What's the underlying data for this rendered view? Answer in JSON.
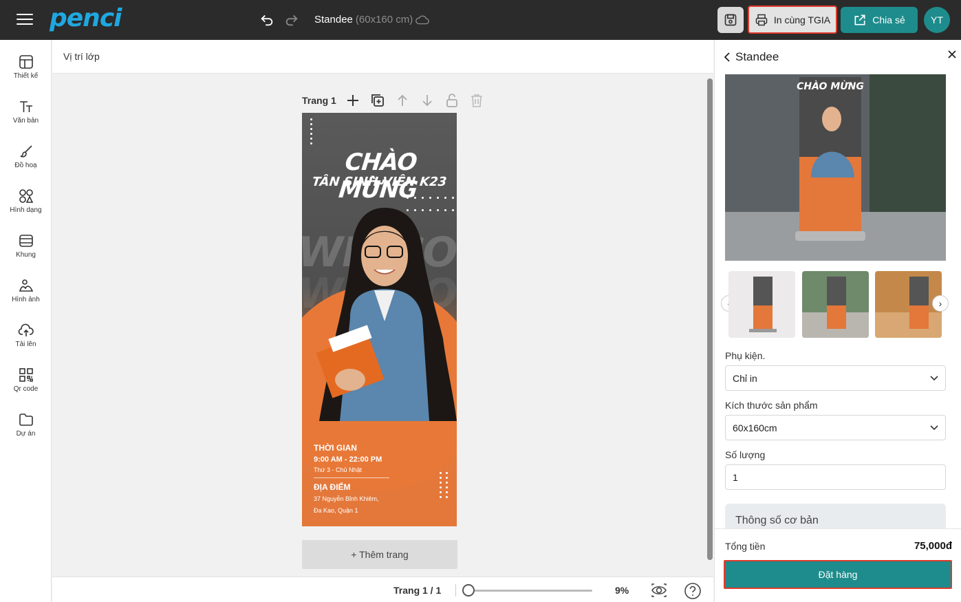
{
  "header": {
    "logo": "penci",
    "doc_title": "Standee",
    "doc_size": "(60x160 cm)",
    "print_label": "In cùng TGIA",
    "share_label": "Chia sẻ",
    "avatar_initials": "YT",
    "accent_color": "#1e8c8c"
  },
  "tools": [
    {
      "label": "Thiết kế",
      "icon": "layout-icon"
    },
    {
      "label": "Văn bản",
      "icon": "text-icon"
    },
    {
      "label": "Đồ hoạ",
      "icon": "brush-icon"
    },
    {
      "label": "Hình dạng",
      "icon": "shapes-icon"
    },
    {
      "label": "Khung",
      "icon": "frame-icon"
    },
    {
      "label": "Hình ảnh",
      "icon": "image-icon"
    },
    {
      "label": "Tải lên",
      "icon": "upload-cloud-icon"
    },
    {
      "label": "Qr code",
      "icon": "qr-code-icon"
    },
    {
      "label": "Dự án",
      "icon": "folder-icon"
    }
  ],
  "layer_bar": {
    "label": "Vị trí lớp"
  },
  "canvas": {
    "page_label": "Trang 1",
    "add_page": "+ Thêm trang"
  },
  "standee": {
    "title1": "CHÀO MỪNG",
    "title2": "TÂN SINH VIÊN K23",
    "watermark": "WELCOME",
    "time_heading": "THỜI GIAN",
    "time_value": "9:00 AM - 22:00 PM",
    "days": "Thứ 3 - Chủ Nhật",
    "place_heading": "ĐỊA ĐIỂM",
    "address_line1": "37 Nguyễn Bỉnh Khiêm,",
    "address_line2": "Đa Kao, Quận 1"
  },
  "bottombar": {
    "pager": "Trang 1 / 1",
    "zoom": "9%",
    "zoom_level": 0.09
  },
  "panel": {
    "title": "Standee",
    "accessory_label": "Phụ kiện.",
    "accessory_value": "Chỉ in",
    "size_label": "Kích thước sản phẩm",
    "size_value": "60x160cm",
    "qty_label": "Số lượng",
    "qty_value": "1",
    "spec_label": "Thông số cơ bản",
    "total_label": "Tổng tiền",
    "total_value": "75,000đ",
    "order_label": "Đặt hàng"
  }
}
